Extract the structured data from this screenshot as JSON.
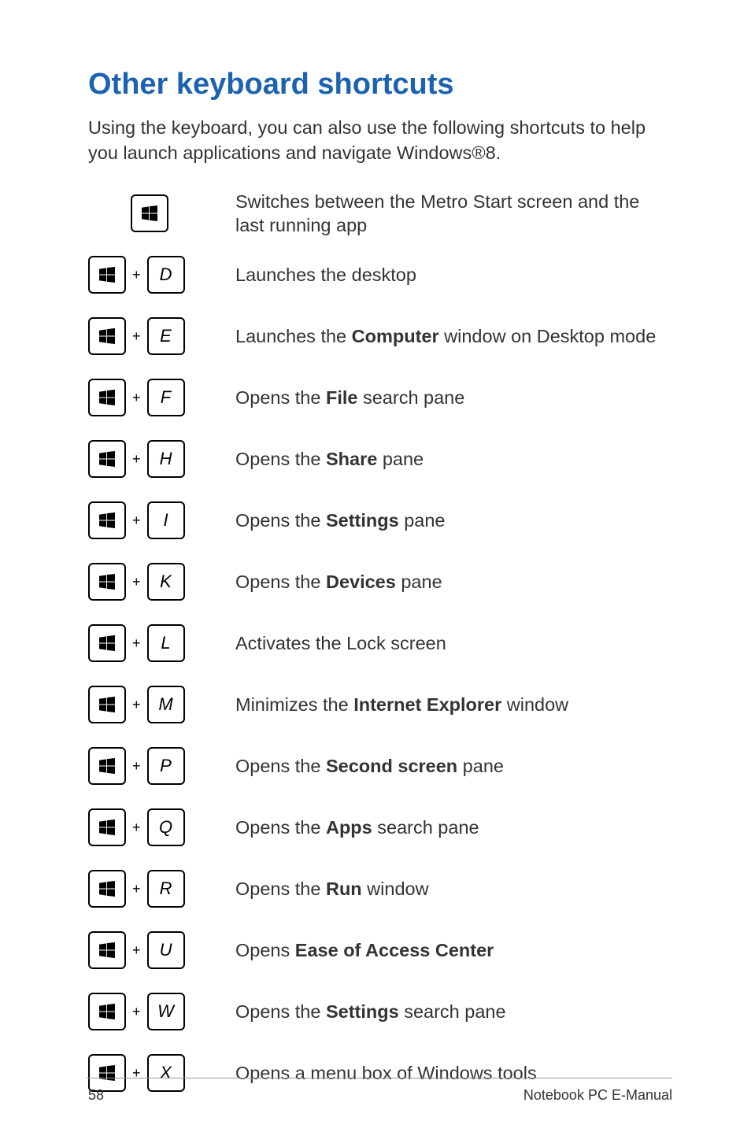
{
  "title": "Other keyboard shortcuts",
  "intro": "Using the keyboard, you can also use the following shortcuts to help you launch applications and navigate Windows®8.",
  "plus": "+",
  "shortcuts": [
    {
      "letter": "",
      "desc": "Switches between the Metro Start screen and the last running app",
      "bold": []
    },
    {
      "letter": "D",
      "desc": "Launches the desktop",
      "bold": []
    },
    {
      "letter": "E",
      "desc": "Launches the |Computer| window on Desktop mode",
      "bold": [
        "Computer"
      ]
    },
    {
      "letter": "F",
      "desc": "Opens the |File| search pane",
      "bold": [
        "File"
      ]
    },
    {
      "letter": "H",
      "desc": "Opens the |Share| pane",
      "bold": [
        "Share"
      ]
    },
    {
      "letter": "I",
      "desc": "Opens the |Settings| pane",
      "bold": [
        "Settings"
      ]
    },
    {
      "letter": "K",
      "desc": "Opens the |Devices| pane",
      "bold": [
        "Devices"
      ]
    },
    {
      "letter": "L",
      "desc": "Activates the Lock screen",
      "bold": []
    },
    {
      "letter": "M",
      "desc": "Minimizes the |Internet Explorer| window",
      "bold": [
        "Internet Explorer"
      ]
    },
    {
      "letter": "P",
      "desc": "Opens the |Second screen| pane",
      "bold": [
        "Second screen"
      ]
    },
    {
      "letter": "Q",
      "desc": "Opens the |Apps| search pane",
      "bold": [
        "Apps"
      ]
    },
    {
      "letter": "R",
      "desc": "Opens the |Run| window",
      "bold": [
        "Run"
      ]
    },
    {
      "letter": "U",
      "desc": "Opens |Ease of Access Center|",
      "bold": [
        "Ease of Access Center"
      ]
    },
    {
      "letter": "W",
      "desc": "Opens the |Settings| search pane",
      "bold": [
        "Settings"
      ]
    },
    {
      "letter": "X",
      "desc": "Opens a menu box of Windows tools",
      "bold": []
    }
  ],
  "footer": {
    "page": "58",
    "manual": "Notebook PC E-Manual"
  }
}
